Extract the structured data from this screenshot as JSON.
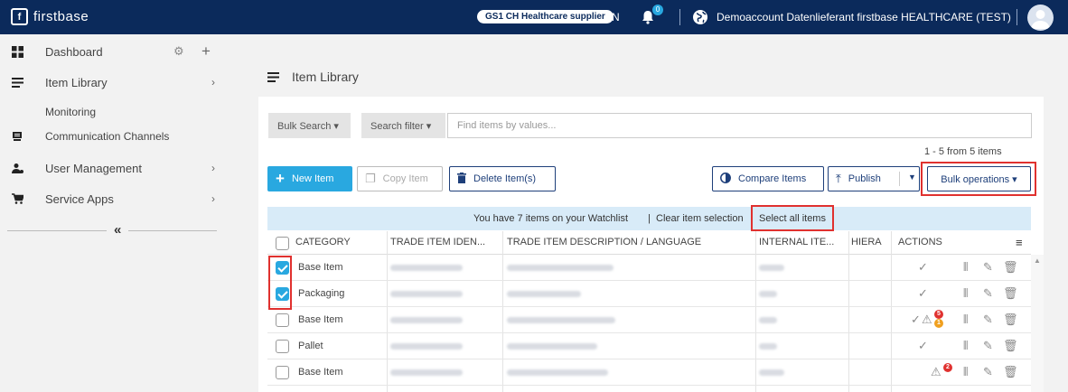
{
  "topbar": {
    "logo_mark": "f",
    "logo_text": "firstbase",
    "badge": "GS1 CH Healthcare supplier",
    "language": "EN",
    "notification_count": "0",
    "account": "Demoaccount Datenlieferant firstbase HEALTHCARE (TEST)"
  },
  "sidebar": {
    "dashboard": "Dashboard",
    "item_library": "Item Library",
    "monitoring": "Monitoring",
    "communication_channels": "Communication Channels",
    "user_management": "User Management",
    "service_apps": "Service Apps",
    "collapse": "«"
  },
  "page": {
    "title": "Item Library"
  },
  "search": {
    "bulk_search": "Bulk Search ▾",
    "search_filter": "Search filter ▾",
    "placeholder": "Find items by values...",
    "count": "1 - 5 from 5 items"
  },
  "toolbar": {
    "new_item": "New Item",
    "copy_item": "Copy Item",
    "delete_items": "Delete Item(s)",
    "compare_items": "Compare Items",
    "publish": "Publish",
    "bulk_operations": "Bulk operations ▾"
  },
  "watchlist": {
    "text": "You have 7 items on your Watchlist",
    "clear": "Clear item selection",
    "select_all": "Select all items"
  },
  "table": {
    "headers": {
      "category": "CATEGORY",
      "trade_item_id": "TRADE ITEM IDEN...",
      "description": "TRADE ITEM DESCRIPTION / LANGUAGE",
      "internal": "INTERNAL ITE...",
      "hierarchy": "HIERA",
      "actions": "ACTIONS"
    },
    "rows": [
      {
        "category": "Base Item",
        "checked": true
      },
      {
        "category": "Packaging",
        "checked": true
      },
      {
        "category": "Base Item",
        "checked": false,
        "badges": [
          "5",
          "1"
        ]
      },
      {
        "category": "Pallet",
        "checked": false
      },
      {
        "category": "Base Item",
        "checked": false,
        "badges": [
          "2"
        ]
      }
    ]
  },
  "colors": {
    "nav": "#0b2a5b",
    "accent": "#29a8e0",
    "highlight": "#e0312f"
  }
}
